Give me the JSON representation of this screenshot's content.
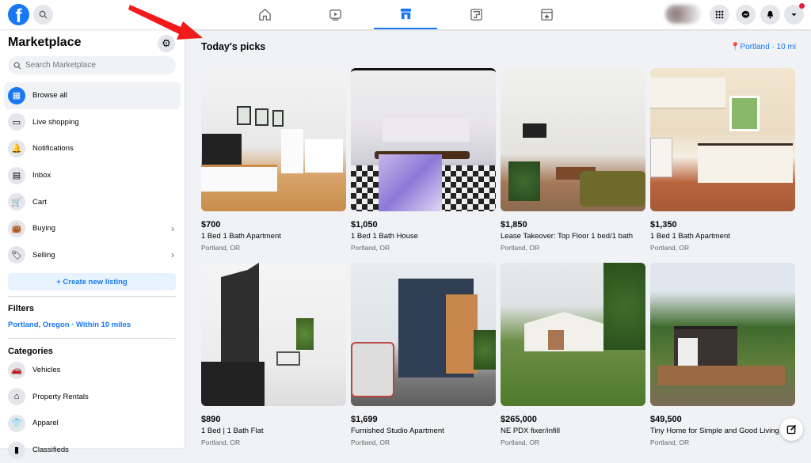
{
  "topbar": {
    "logo": "f",
    "search_icon": "search-icon",
    "nav": [
      {
        "name": "home",
        "icon": "⌂",
        "active": false
      },
      {
        "name": "watch",
        "icon": "▶",
        "active": false
      },
      {
        "name": "marketplace",
        "icon": "▦",
        "active": true
      },
      {
        "name": "groups",
        "icon": "◫",
        "active": false
      },
      {
        "name": "gaming",
        "icon": "★",
        "active": false
      }
    ],
    "right_icons": [
      "menu-grid-icon",
      "messenger-icon",
      "bell-icon",
      "account-chevron-icon"
    ],
    "accent": "#1877f2",
    "notification_color": "#e41e3f"
  },
  "sidebar": {
    "title": "Marketplace",
    "search_placeholder": "Search Marketplace",
    "items": [
      {
        "label": "Browse all",
        "icon": "▦",
        "active": true
      },
      {
        "label": "Live shopping",
        "icon": "▭"
      },
      {
        "label": "Notifications",
        "icon": "🔔"
      },
      {
        "label": "Inbox",
        "icon": "▤"
      },
      {
        "label": "Cart",
        "icon": "🛒"
      },
      {
        "label": "Buying",
        "icon": "👜",
        "chevron": true
      },
      {
        "label": "Selling",
        "icon": "🏷",
        "chevron": true
      }
    ],
    "create_label": "+ Create new listing",
    "filters_heading": "Filters",
    "filter_value": "Portland, Oregon · Within 10 miles",
    "categories_heading": "Categories",
    "categories": [
      {
        "label": "Vehicles",
        "icon": "🚗"
      },
      {
        "label": "Property Rentals",
        "icon": "⌂"
      },
      {
        "label": "Apparel",
        "icon": "👕"
      },
      {
        "label": "Classifieds",
        "icon": "▮"
      }
    ]
  },
  "main": {
    "heading": "Today's picks",
    "location": "Portland · 10 mi",
    "listings": [
      {
        "price": "$700",
        "title": "1 Bed 1 Bath Apartment",
        "city": "Portland, OR"
      },
      {
        "price": "$1,050",
        "title": "1 Bed 1 Bath House",
        "city": "Portland, OR"
      },
      {
        "price": "$1,850",
        "title": "Lease Takeover: Top Floor 1 bed/1 bath",
        "city": "Portland, OR"
      },
      {
        "price": "$1,350",
        "title": "1 Bed 1 Bath Apartment",
        "city": "Portland, OR"
      },
      {
        "price": "$890",
        "title": "1 Bed | 1 Bath Flat",
        "city": "Portland, OR"
      },
      {
        "price": "$1,699",
        "title": "Furnished Studio Apartment",
        "city": "Portland, OR"
      },
      {
        "price": "$265,000",
        "title": "NE PDX fixer/infill",
        "city": "Portland, OR"
      },
      {
        "price": "$49,500",
        "title": "Tiny Home for Simple and Good Living",
        "city": "Portland, OR"
      }
    ]
  }
}
